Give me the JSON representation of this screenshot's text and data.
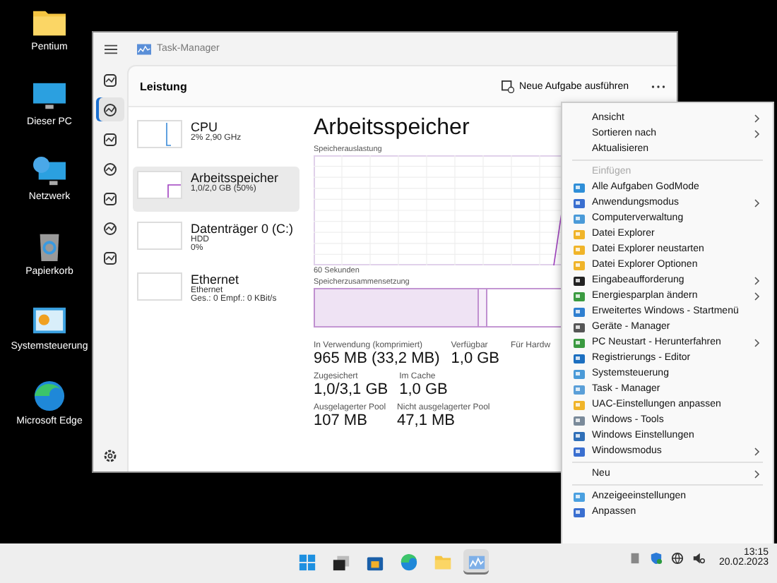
{
  "desktop_icons": [
    {
      "label": "Pentium"
    },
    {
      "label": "Dieser PC"
    },
    {
      "label": "Netzwerk"
    },
    {
      "label": "Papierkorb"
    },
    {
      "label": "Systemsteuerung"
    },
    {
      "label": "Microsoft Edge"
    }
  ],
  "window": {
    "title": "Task-Manager",
    "nav": [
      {
        "selected": false
      },
      {
        "selected": true
      },
      {
        "selected": false
      },
      {
        "selected": false
      },
      {
        "selected": false
      },
      {
        "selected": false
      },
      {
        "selected": false
      }
    ],
    "header": {
      "title": "Leistung",
      "button": "Neue Aufgabe ausführen"
    },
    "perf_items": [
      {
        "name": "CPU",
        "lines": [
          "2% 2,90 GHz"
        ],
        "selected": false
      },
      {
        "name": "Arbeitsspeicher",
        "lines": [
          "1,0/2,0 GB (50%)"
        ],
        "selected": true
      },
      {
        "name": "Datenträger 0 (C:)",
        "lines": [
          "HDD",
          "0%"
        ],
        "selected": false
      },
      {
        "name": "Ethernet",
        "lines": [
          "Ethernet",
          "Ges.: 0 Empf.: 0 KBit/s"
        ],
        "selected": false
      }
    ],
    "detail": {
      "title": "Arbeitsspeicher",
      "graph_label": "Speicherauslastung",
      "graph_footer": "60 Sekunden",
      "composition_label": "Speicherzusammensetzung",
      "stats": [
        [
          {
            "label": "In Verwendung (komprimiert)",
            "value": "965 MB (33,2 MB)"
          },
          {
            "label": "Verfügbar",
            "value": "1,0 GB"
          },
          {
            "label": "Für Hardw"
          }
        ],
        [
          {
            "label": "Zugesichert",
            "value": "1,0/3,1 GB"
          },
          {
            "label": "Im Cache",
            "value": "1,0 GB"
          }
        ],
        [
          {
            "label": "Ausgelagerter Pool",
            "value": "107 MB"
          },
          {
            "label": "Nicht ausgelagerter Pool",
            "value": "47,1 MB"
          }
        ]
      ]
    }
  },
  "context_menu": {
    "sections": [
      [
        {
          "label": "Ansicht",
          "kind": "text",
          "submenu": true,
          "disabled": false
        },
        {
          "label": "Sortieren nach",
          "kind": "text",
          "submenu": true,
          "disabled": false
        },
        {
          "label": "Aktualisieren",
          "kind": "text",
          "submenu": false,
          "disabled": false
        }
      ],
      [
        {
          "label": "Einfügen",
          "kind": "text",
          "submenu": false,
          "disabled": true
        },
        {
          "label": "Alle Aufgaben GodMode",
          "kind": "app",
          "submenu": false,
          "disabled": false
        },
        {
          "label": "Anwendungsmodus",
          "kind": "app",
          "submenu": true,
          "disabled": false
        },
        {
          "label": "Computerverwaltung",
          "kind": "app",
          "submenu": false,
          "disabled": false
        },
        {
          "label": "Datei Explorer",
          "kind": "app",
          "submenu": false,
          "disabled": false
        },
        {
          "label": "Datei Explorer neustarten",
          "kind": "app",
          "submenu": false,
          "disabled": false
        },
        {
          "label": "Datei Explorer Optionen",
          "kind": "app",
          "submenu": false,
          "disabled": false
        },
        {
          "label": "Eingabeaufforderung",
          "kind": "app",
          "submenu": true,
          "disabled": false
        },
        {
          "label": "Energiesparplan ändern",
          "kind": "app",
          "submenu": true,
          "disabled": false
        },
        {
          "label": "Erweitertes Windows - Startmenü",
          "kind": "app",
          "submenu": false,
          "disabled": false
        },
        {
          "label": "Geräte - Manager",
          "kind": "app",
          "submenu": false,
          "disabled": false
        },
        {
          "label": "PC Neustart - Herunterfahren",
          "kind": "app",
          "submenu": true,
          "disabled": false
        },
        {
          "label": "Registrierungs - Editor",
          "kind": "app",
          "submenu": false,
          "disabled": false
        },
        {
          "label": "Systemsteuerung",
          "kind": "app",
          "submenu": false,
          "disabled": false
        },
        {
          "label": "Task - Manager",
          "kind": "app",
          "submenu": false,
          "disabled": false
        },
        {
          "label": "UAC-Einstellungen anpassen",
          "kind": "app",
          "submenu": false,
          "disabled": false
        },
        {
          "label": "Windows - Tools",
          "kind": "app",
          "submenu": false,
          "disabled": false
        },
        {
          "label": "Windows Einstellungen",
          "kind": "app",
          "submenu": false,
          "disabled": false
        },
        {
          "label": "Windowsmodus",
          "kind": "app",
          "submenu": true,
          "disabled": false
        }
      ],
      [
        {
          "label": "Neu",
          "kind": "text",
          "submenu": true,
          "disabled": false
        }
      ],
      [
        {
          "label": "Anzeigeeinstellungen",
          "kind": "app",
          "submenu": false,
          "disabled": false
        },
        {
          "label": "Anpassen",
          "kind": "app",
          "submenu": false,
          "disabled": false
        }
      ]
    ]
  },
  "taskbar": {
    "apps": [
      {
        "selected": false
      },
      {
        "selected": false
      },
      {
        "selected": false
      },
      {
        "selected": false
      },
      {
        "selected": false
      },
      {
        "selected": true
      }
    ],
    "time": "13:15",
    "date": "20.02.2023"
  }
}
